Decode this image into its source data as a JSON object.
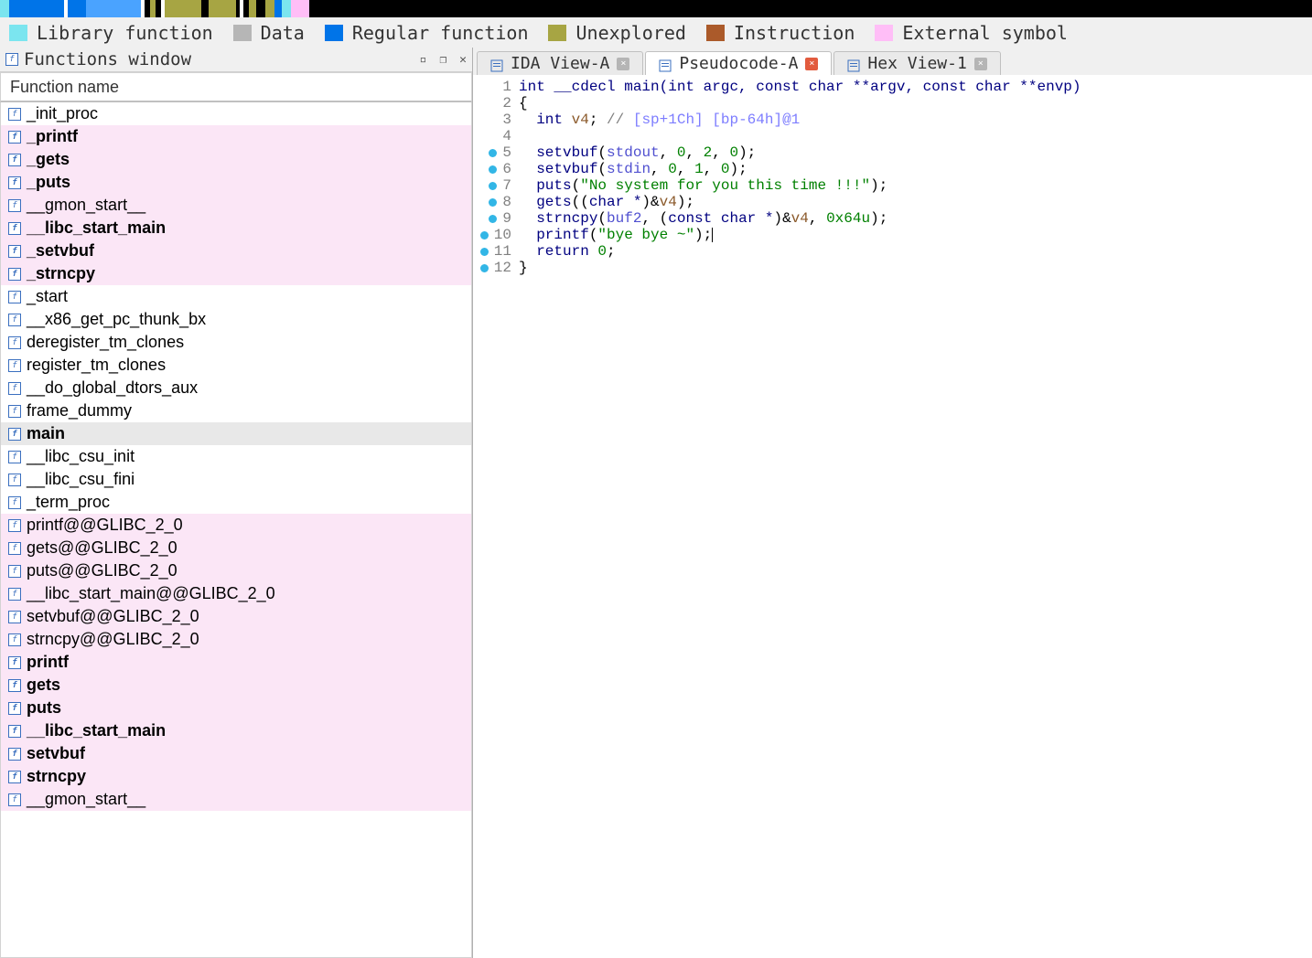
{
  "legend": [
    {
      "color": "#7be5ef",
      "label": "Library function"
    },
    {
      "color": "#b6b6b6",
      "label": "Data"
    },
    {
      "color": "#0074e8",
      "label": "Regular function"
    },
    {
      "color": "#a7a543",
      "label": "Unexplored"
    },
    {
      "color": "#ab5a2a",
      "label": "Instruction"
    },
    {
      "color": "#ffbef7",
      "label": "External symbol"
    }
  ],
  "functions_window": {
    "title": "Functions window",
    "column": "Function name",
    "items": [
      {
        "name": "_init_proc",
        "bold": false,
        "pink": false
      },
      {
        "name": "_printf",
        "bold": true,
        "pink": true
      },
      {
        "name": "_gets",
        "bold": true,
        "pink": true
      },
      {
        "name": "_puts",
        "bold": true,
        "pink": true
      },
      {
        "name": "__gmon_start__",
        "bold": false,
        "pink": true
      },
      {
        "name": "__libc_start_main",
        "bold": true,
        "pink": true
      },
      {
        "name": "_setvbuf",
        "bold": true,
        "pink": true
      },
      {
        "name": "_strncpy",
        "bold": true,
        "pink": true
      },
      {
        "name": "_start",
        "bold": false,
        "pink": false
      },
      {
        "name": "__x86_get_pc_thunk_bx",
        "bold": false,
        "pink": false
      },
      {
        "name": "deregister_tm_clones",
        "bold": false,
        "pink": false
      },
      {
        "name": "register_tm_clones",
        "bold": false,
        "pink": false
      },
      {
        "name": "__do_global_dtors_aux",
        "bold": false,
        "pink": false
      },
      {
        "name": "frame_dummy",
        "bold": false,
        "pink": false
      },
      {
        "name": "main",
        "bold": true,
        "pink": false,
        "selected": true
      },
      {
        "name": "__libc_csu_init",
        "bold": false,
        "pink": false
      },
      {
        "name": "__libc_csu_fini",
        "bold": false,
        "pink": false
      },
      {
        "name": "_term_proc",
        "bold": false,
        "pink": false
      },
      {
        "name": "printf@@GLIBC_2_0",
        "bold": false,
        "pink": true
      },
      {
        "name": "gets@@GLIBC_2_0",
        "bold": false,
        "pink": true
      },
      {
        "name": "puts@@GLIBC_2_0",
        "bold": false,
        "pink": true
      },
      {
        "name": "__libc_start_main@@GLIBC_2_0",
        "bold": false,
        "pink": true
      },
      {
        "name": "setvbuf@@GLIBC_2_0",
        "bold": false,
        "pink": true
      },
      {
        "name": "strncpy@@GLIBC_2_0",
        "bold": false,
        "pink": true
      },
      {
        "name": "printf",
        "bold": true,
        "pink": true
      },
      {
        "name": "gets",
        "bold": true,
        "pink": true
      },
      {
        "name": "puts",
        "bold": true,
        "pink": true
      },
      {
        "name": "__libc_start_main",
        "bold": true,
        "pink": true
      },
      {
        "name": "setvbuf",
        "bold": true,
        "pink": true
      },
      {
        "name": "strncpy",
        "bold": true,
        "pink": true
      },
      {
        "name": "__gmon_start__",
        "bold": false,
        "pink": true
      }
    ]
  },
  "tabs": [
    {
      "label": "IDA View-A",
      "icon": "ida-view-icon",
      "close": "gray"
    },
    {
      "label": "Pseudocode-A",
      "icon": "pseudocode-icon",
      "close": "red",
      "active": true
    },
    {
      "label": "Hex View-1",
      "icon": "hex-view-icon",
      "close": "gray"
    }
  ],
  "code": {
    "signature_kw": "int __cdecl ",
    "signature_fn": "main",
    "signature_args": "(int argc, const char **argv, const char **envp)",
    "v4_decl_ty": "int",
    "v4_decl_id": " v4",
    "v4_comment": "// ",
    "v4_sref": "[sp+1Ch] [bp-64h]@1",
    "l5_fn": "setvbuf",
    "l5_args_a": "(",
    "l5_stdout": "stdout",
    "l5_args_b": ", ",
    "l5_n0": "0",
    "l5_args_c": ", ",
    "l5_n2": "2",
    "l5_args_d": ", ",
    "l5_n0b": "0",
    "l5_args_e": ");",
    "l6_fn": "setvbuf",
    "l6_args_a": "(",
    "l6_stdin": "stdin",
    "l6_args_b": ", ",
    "l6_n0": "0",
    "l6_args_c": ", ",
    "l6_n1": "1",
    "l6_args_d": ", ",
    "l6_n0b": "0",
    "l6_args_e": ");",
    "l7_fn": "puts",
    "l7_args_a": "(",
    "l7_str": "\"No system for you this time !!!\"",
    "l7_args_b": ");",
    "l8_fn": "gets",
    "l8_args_a": "((",
    "l8_cast": "char *",
    "l8_args_b": ")&",
    "l8_v4": "v4",
    "l8_args_c": ");",
    "l9_fn": "strncpy",
    "l9_args_a": "(",
    "l9_buf": "buf2",
    "l9_args_b": ", (",
    "l9_cast": "const char *",
    "l9_args_c": ")&",
    "l9_v4": "v4",
    "l9_args_d": ", ",
    "l9_hex": "0x64u",
    "l9_args_e": ");",
    "l10_fn": "printf",
    "l10_args_a": "(",
    "l10_str": "\"bye bye ~\"",
    "l10_args_b": ");",
    "l11_ret": "return ",
    "l11_zero": "0",
    "l11_semi": ";",
    "open_brace": "{",
    "close_brace": "}"
  },
  "line_numbers": [
    "1",
    "2",
    "3",
    "4",
    "5",
    "6",
    "7",
    "8",
    "9",
    "10",
    "11",
    "12"
  ],
  "line_dots": [
    false,
    false,
    false,
    false,
    true,
    true,
    true,
    true,
    true,
    true,
    true,
    true
  ]
}
